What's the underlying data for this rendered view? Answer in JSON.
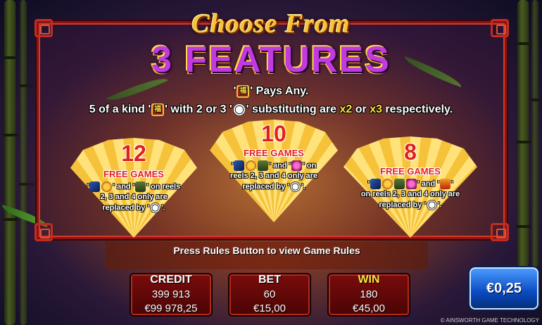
{
  "title": {
    "line1": "Choose From",
    "line2": "3 FEATURES"
  },
  "info": {
    "pays_any_open": "'",
    "pays_any_text": "' Pays Any.",
    "line2_a": "5 of a kind '",
    "line2_b": "' with 2 or 3 '",
    "line2_c": "' substituting are ",
    "line2_x2": "x2",
    "line2_or": " or ",
    "line2_x3": "x3",
    "line2_d": " respectively.",
    "fu_glyph": "福"
  },
  "features": [
    {
      "count": "12",
      "label": "FREE GAMES",
      "desc_a": "'",
      "desc_and": "' and '",
      "desc_b": "' on reels",
      "desc_line2": "2, 3 and 4 only are",
      "desc_line3": "replaced by '",
      "desc_end": "'."
    },
    {
      "count": "10",
      "label": "FREE GAMES",
      "desc_a": "'",
      "desc_and": "' and '",
      "desc_b": "' on",
      "desc_line2": "reels 2, 3 and 4 only are",
      "desc_line3": "replaced by '",
      "desc_end": "'."
    },
    {
      "count": "8",
      "label": "FREE GAMES",
      "desc_a": "'",
      "desc_and": "' and '",
      "desc_b": "'",
      "desc_line2": "on reels 2, 3 and 4 only are",
      "desc_line3": "replaced by '",
      "desc_end": "'."
    }
  ],
  "rules_text": "Press Rules Button to view Game Rules",
  "meters": {
    "credit": {
      "label": "CREDIT",
      "credits": "399 913",
      "amount": "€99 978,25"
    },
    "bet": {
      "label": "BET",
      "credits": "60",
      "amount": "€15,00"
    },
    "win": {
      "label": "WIN",
      "credits": "180",
      "amount": "€45,00"
    }
  },
  "denomination": "€0,25",
  "copyright": "© AINSWORTH GAME TECHNOLOGY",
  "colors": {
    "title_gold": "#f7c23a",
    "title_purple": "#c03ae0",
    "frame_red": "#8a1414",
    "fan_gold": "#f6c23a",
    "count_red": "#e2201a",
    "denom_blue": "#0a4ac0"
  }
}
